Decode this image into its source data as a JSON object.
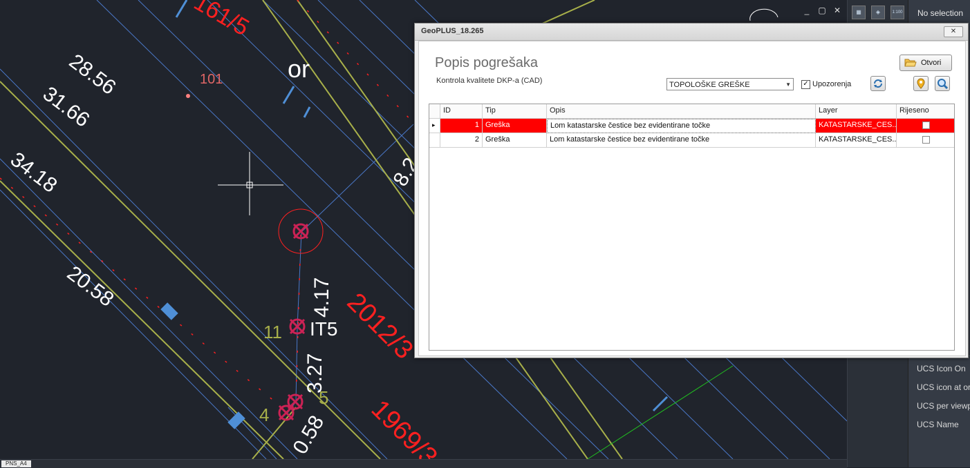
{
  "cad": {
    "labels": {
      "parcel_1": "161/5",
      "parcel_2": "2012/3",
      "parcel_3": "1969/3",
      "dim_2856": "28.56",
      "dim_3166": "31.66",
      "dim_3418": "34.18",
      "dim_2058": "20.58",
      "dim_417": "4.17",
      "dim_327": "3.27",
      "dim_058": "0.58",
      "dim_82": "8.2",
      "point_101": "101",
      "text_or": "or",
      "point_11": "11",
      "point_it5": "IT5",
      "point_5": "5",
      "point_4": "4"
    },
    "layout_tab": "PNS_A4",
    "colors": {
      "background": "#20242c",
      "parcel_text": "#ff2020",
      "boundary_line": "#a8b04a",
      "thin_line": "#4a78c8",
      "marker": "#cc2255"
    }
  },
  "window_controls": [
    "_",
    "▢",
    "✕"
  ],
  "right_toolbar": {
    "icons": [
      "viewport-icon",
      "ucs-icon",
      "scale-icon"
    ],
    "scale_label": "1:100"
  },
  "properties": {
    "selection": "No selection",
    "items": [
      "UCS Icon On",
      "UCS icon at ori",
      "UCS per viewpo",
      "UCS Name"
    ]
  },
  "dialog": {
    "title": "GeoPLUS_18.265",
    "close_label": "✕",
    "heading": "Popis pogrešaka",
    "subheading": "Kontrola kvalitete DKP-a (CAD)",
    "filter_value": "TOPOLOŠKE GREŠKE",
    "warnings_checked": "✓",
    "warnings_label": "Upozorenja",
    "open_label": "Otvori",
    "grid": {
      "columns": [
        "ID",
        "Tip",
        "Opis",
        "Layer",
        "Rijeseno"
      ],
      "row_indicator": "▸",
      "rows": [
        {
          "id": "1",
          "tip": "Greška",
          "opis": "Lom katastarske čestice bez evidentirane točke",
          "layer": "KATASTARSKE_CES...",
          "rijeseno": false
        },
        {
          "id": "2",
          "tip": "Greška",
          "opis": "Lom katastarske čestice bez evidentirane točke",
          "layer": "KATASTARSKE_CES...",
          "rijeseno": false
        }
      ]
    },
    "colors": {
      "selected_row": "#ff0000"
    }
  }
}
